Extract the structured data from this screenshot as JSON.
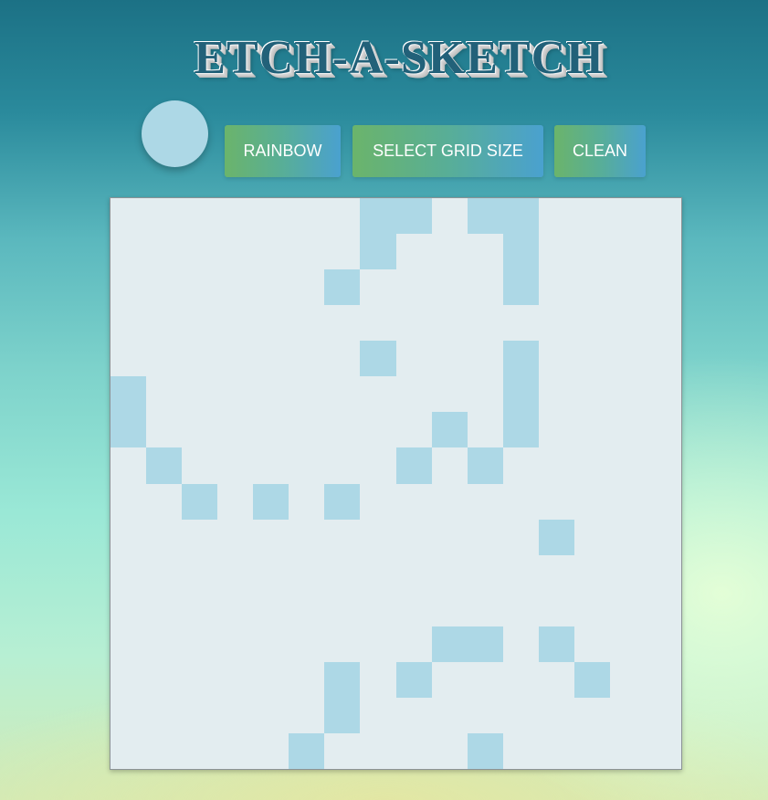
{
  "title": "ETCH-A-SKETCH",
  "color_picker": {
    "value": "#add8e6"
  },
  "buttons": {
    "rainbow": "RAINBOW",
    "grid_size": "SELECT GRID SIZE",
    "clean": "CLEAN"
  },
  "grid": {
    "size": 16,
    "background_color": "#e3edf0",
    "fill_color": "#add8e6",
    "filled_cells": [
      [
        0,
        7
      ],
      [
        0,
        8
      ],
      [
        0,
        10
      ],
      [
        0,
        11
      ],
      [
        1,
        7
      ],
      [
        1,
        11
      ],
      [
        2,
        6
      ],
      [
        2,
        11
      ],
      [
        4,
        7
      ],
      [
        4,
        11
      ],
      [
        5,
        0
      ],
      [
        5,
        11
      ],
      [
        6,
        0
      ],
      [
        6,
        9
      ],
      [
        6,
        11
      ],
      [
        7,
        1
      ],
      [
        7,
        8
      ],
      [
        7,
        10
      ],
      [
        8,
        2
      ],
      [
        8,
        4
      ],
      [
        8,
        6
      ],
      [
        9,
        12
      ],
      [
        12,
        9
      ],
      [
        12,
        10
      ],
      [
        12,
        12
      ],
      [
        13,
        6
      ],
      [
        13,
        8
      ],
      [
        13,
        13
      ],
      [
        14,
        6
      ],
      [
        15,
        5
      ],
      [
        15,
        10
      ]
    ]
  }
}
